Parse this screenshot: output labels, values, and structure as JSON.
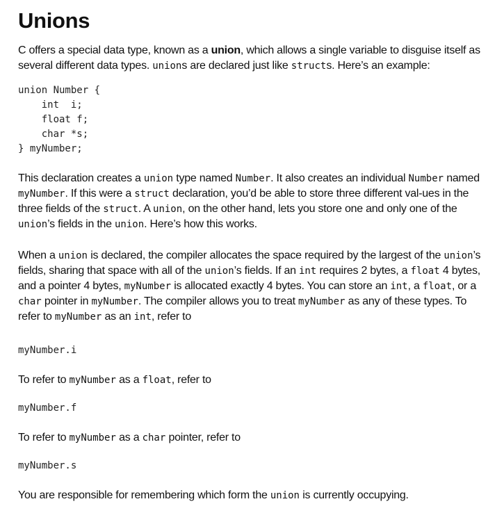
{
  "heading": "Unions",
  "p1": {
    "a": "C offers a special data type, known as a ",
    "b": "union",
    "c": ", which allows a single variable to disguise itself as several different data types. ",
    "d": "union",
    "e": "s are declared just like ",
    "f": "struct",
    "g": "s. Here’s an example:"
  },
  "code_block": "union Number {\n    int  i;\n    float f;\n    char *s;\n} myNumber;",
  "p2": {
    "a": "This declaration creates a ",
    "b": "union",
    "c": " type named ",
    "d": "Number",
    "e": ". It also creates an individual ",
    "f": "Number",
    "g": " named ",
    "h": "myNumber",
    "i": ". If this were a ",
    "j": "struct",
    "k": " declaration, you’d be able to store three different val-ues in the three fields of the ",
    "l": "struct",
    "m": ". A ",
    "n": "union",
    "o": ", on the other hand, lets you store one and only one of the ",
    "p": "union",
    "q": "’s fields in the ",
    "r": "union",
    "s": ". Here’s how this works."
  },
  "p3": {
    "a": "When a ",
    "b": "union",
    "c": " is declared, the compiler allocates the space required by the largest of the ",
    "d": "union",
    "e": "’s fields, sharing that space with all of the ",
    "f": "union",
    "g": "’s fields. If an ",
    "h": "int",
    "i": " requires 2 bytes, a ",
    "j": "float",
    "k": " 4 bytes, and a pointer 4 bytes, ",
    "l": "myNumber",
    "m": " is allocated exactly 4 bytes. You can store an ",
    "n": "int",
    "o": ", a ",
    "p": "float",
    "q": ", or a ",
    "r": "char",
    "s": " pointer in ",
    "t": "myNumber",
    "u": ". The compiler allows you to treat ",
    "v": "myNumber",
    "w": " as any of these types. To refer to ",
    "x": "myNumber",
    "y": " as an ",
    "z": "int",
    "z2": ", refer to"
  },
  "code_i": "myNumber.i",
  "p4": {
    "a": "To refer to ",
    "b": "myNumber",
    "c": " as a ",
    "d": "float",
    "e": ", refer to"
  },
  "code_f": "myNumber.f",
  "p5": {
    "a": "To refer to ",
    "b": "myNumber",
    "c": " as a ",
    "d": "char",
    "e": " pointer, refer to"
  },
  "code_s": "myNumber.s",
  "p6": {
    "a": "You are responsible for remembering which form the ",
    "b": "union",
    "c": " is currently occupying."
  }
}
